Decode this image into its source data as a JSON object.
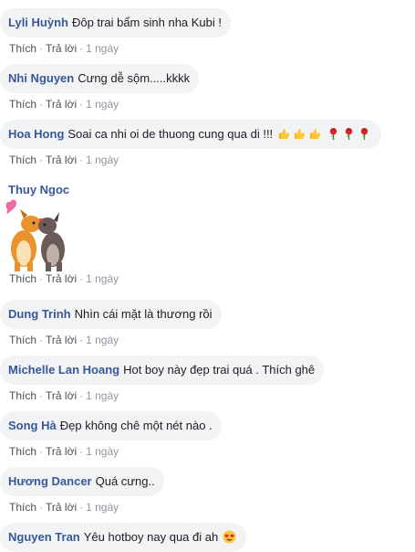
{
  "actions": {
    "like": "Thích",
    "reply": "Trả lời",
    "sep": "·",
    "time": "1 ngày"
  },
  "comments": [
    {
      "author": "Lyli Huỳnh",
      "text": "Đôp trai bẩm sinh nha Kubi !"
    },
    {
      "author": "Nhi Nguyen",
      "text": "Cưng dễ sộm.....kkkk"
    },
    {
      "author": "Hoa Hong",
      "text": "Soai ca nhi oi de thuong cung qua di !!!",
      "emojis": [
        "thumbs-up-icon",
        "thumbs-up-icon",
        "thumbs-up-icon",
        "rose-icon",
        "rose-icon",
        "rose-icon"
      ]
    },
    {
      "author": "Thuy Ngoc",
      "sticker": "dogs-kissing-sticker"
    },
    {
      "author": "Dung Trinh",
      "text": "Nhìn cái mặt là thương rồi"
    },
    {
      "author": "Michelle Lan Hoang",
      "text": "Hot boy này đẹp trai quá . Thích ghê"
    },
    {
      "author": "Song Hà",
      "text": "Đẹp không chê một nét nào ."
    },
    {
      "author": "Hương Dancer",
      "text": "Quá cưng.."
    },
    {
      "author": "Nguyen Tran",
      "text": "Yêu hotboy nay qua đi ah",
      "emojis": [
        "heart-eyes-icon"
      ]
    }
  ],
  "colors": {
    "author": "#385898",
    "bubble": "#f2f3f5",
    "meta": "#90949c"
  }
}
